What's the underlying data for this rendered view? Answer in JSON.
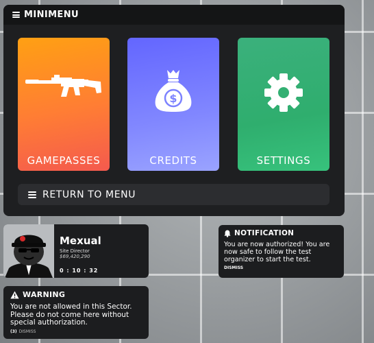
{
  "menu": {
    "title": "MINIMENU",
    "tiles": [
      {
        "label": "GAMEPASSES",
        "icon": "rifle-icon",
        "color_top": "#ffa013",
        "color_bottom": "#f45a4e"
      },
      {
        "label": "CREDITS",
        "icon": "money-bag-icon",
        "color_top": "#6366ff",
        "color_bottom": "#9aa3ff"
      },
      {
        "label": "SETTINGS",
        "icon": "gear-icon",
        "color_top": "#3bb07c",
        "color_bottom": "#37c27c"
      }
    ],
    "return_label": "RETURN TO MENU"
  },
  "profile": {
    "name": "Mexual",
    "role": "Site Director",
    "credits": "$69,420,290",
    "timer": "0 : 10 : 32"
  },
  "notification": {
    "title": "NOTIFICATION",
    "body": "You are now authorized! You are now safe to follow the test organizer to start the test.",
    "dismiss": "DISMISS"
  },
  "warning": {
    "title": "WARNING",
    "body": "You are not allowed in this Sector. Please do not come here without special authorization.",
    "countdown": "(3)",
    "dismiss": "DISMISS"
  }
}
